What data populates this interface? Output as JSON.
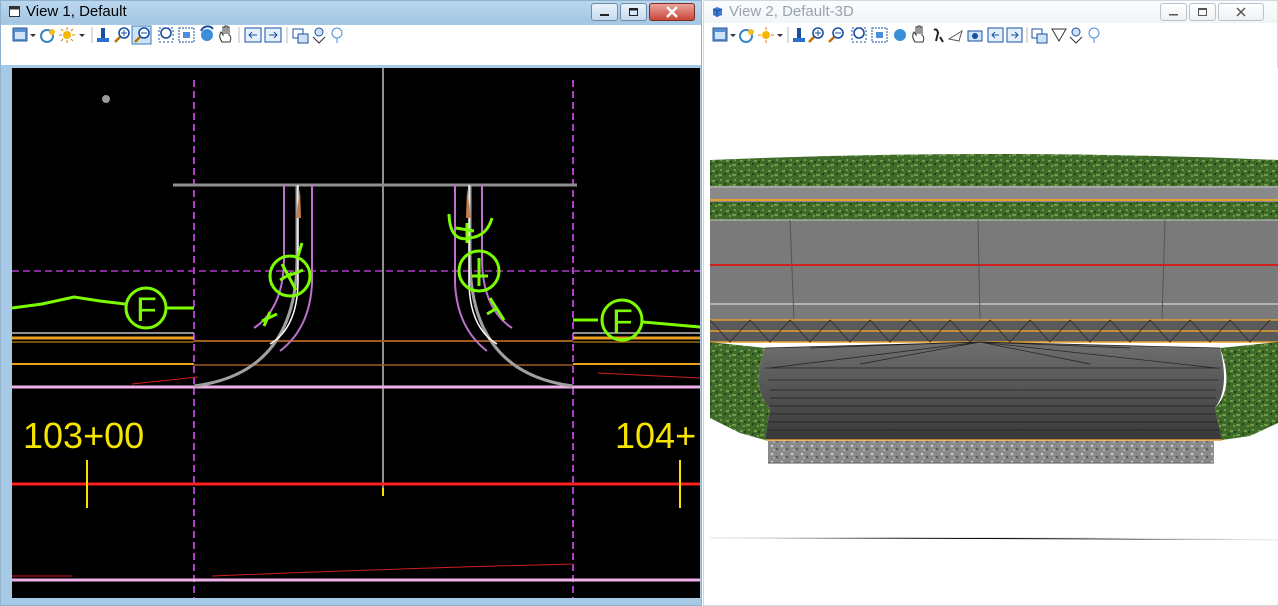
{
  "view1": {
    "title": "View 1, Default",
    "stations": [
      "103+00",
      "104+"
    ],
    "symbol_letter": "F",
    "colors": {
      "background": "#000000",
      "station_text": "#f5e400",
      "symbol": "#7cfc00",
      "centerline": "#ff2020"
    }
  },
  "view2": {
    "title": "View 2, Default-3D",
    "colors": {
      "grass": "#3e6b2a",
      "asphalt": "#7a7a7a",
      "stripe_red": "#d02020",
      "stripe_yellow": "#e5a030"
    }
  },
  "toolbar_icons": [
    "view-display-icon",
    "level-display-icon",
    "lighting-icon",
    "update-view-icon",
    "zoom-in-icon",
    "zoom-out-icon",
    "window-area-icon",
    "fit-view-icon",
    "rotate-view-icon",
    "pan-view-icon",
    "previous-view-icon",
    "next-view-icon",
    "copy-view-icon",
    "clip-volume-icon"
  ]
}
